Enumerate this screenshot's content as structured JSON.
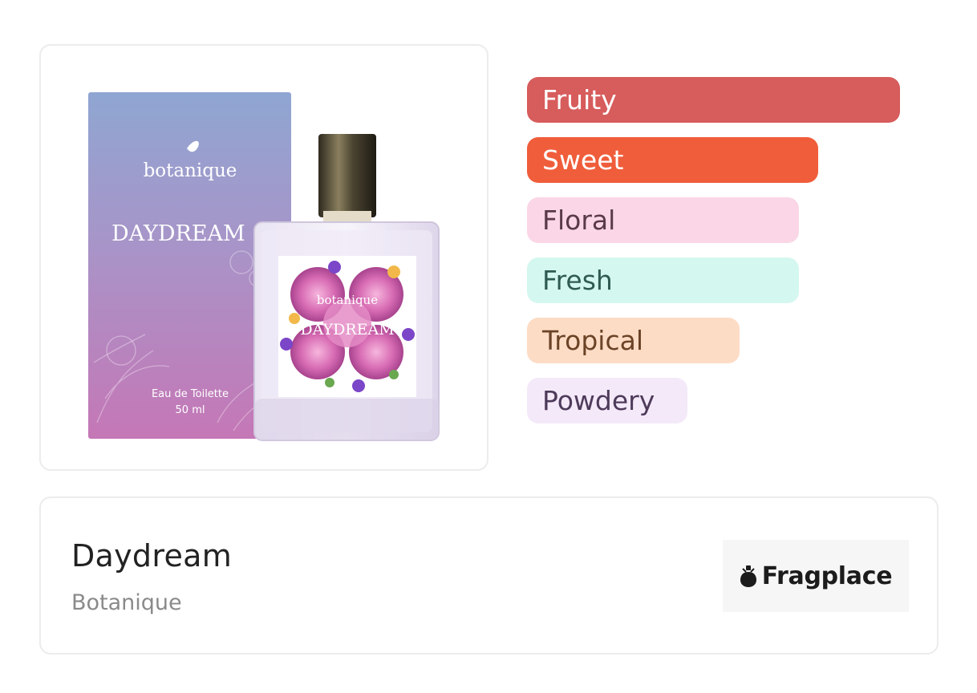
{
  "product": {
    "name": "Daydream",
    "brand": "Botanique",
    "image_alt": "Botanique Daydream Eau de Toilette bottle and box",
    "packaging": {
      "box_brand": "botanique",
      "box_title": "DAYDREAM",
      "box_type": "Eau de Toilette",
      "box_size": "50 ml",
      "label_brand": "botanique",
      "label_title": "DAYDREAM"
    }
  },
  "accords": [
    {
      "label": "Fruity",
      "strength": 1.0,
      "bg": "#d75c5c",
      "fg": "#ffffff"
    },
    {
      "label": "Sweet",
      "strength": 0.78,
      "bg": "#f05d3b",
      "fg": "#ffffff"
    },
    {
      "label": "Floral",
      "strength": 0.73,
      "bg": "#fad6e6",
      "fg": "#5a3a48"
    },
    {
      "label": "Fresh",
      "strength": 0.73,
      "bg": "#d4f7f0",
      "fg": "#2f5a52"
    },
    {
      "label": "Tropical",
      "strength": 0.57,
      "bg": "#fddcc6",
      "fg": "#6b4326"
    },
    {
      "label": "Powdery",
      "strength": 0.43,
      "bg": "#f4e9f9",
      "fg": "#4e3a5a"
    }
  ],
  "logo": {
    "text": "Fragplace",
    "icon": "perfume-bottle-icon"
  }
}
